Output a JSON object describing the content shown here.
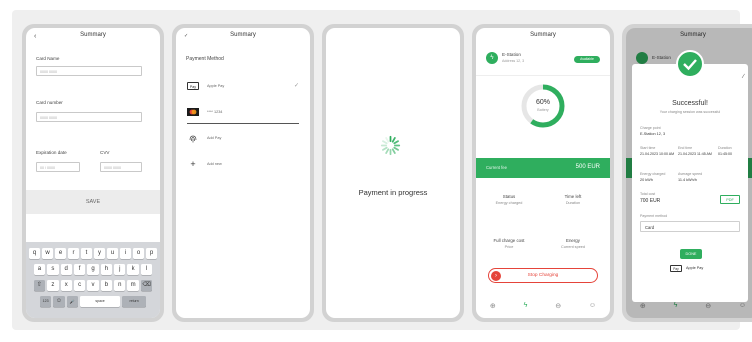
{
  "colors": {
    "accent": "#2fae5e",
    "danger": "#e5443a",
    "board": "#efefef",
    "frame": "#d2d2d2"
  },
  "screen1": {
    "title": "Summary",
    "back_icon": "chevron-left-icon",
    "labels": {
      "card_name": "Card Name",
      "card_number": "Card number",
      "expiration": "Expiration date",
      "cvv": "CVV"
    },
    "placeholders": {
      "card_name": "0000 0000",
      "card_number": "0000 0000",
      "expiration": "00 / 0000",
      "cvv": "0000 0000"
    },
    "save_label": "SAVE",
    "keyboard": {
      "row1": [
        "q",
        "w",
        "e",
        "r",
        "t",
        "y",
        "u",
        "i",
        "o",
        "p"
      ],
      "row2": [
        "a",
        "s",
        "d",
        "f",
        "g",
        "h",
        "j",
        "k",
        "l"
      ],
      "row3": [
        "z",
        "x",
        "c",
        "v",
        "b",
        "n",
        "m"
      ],
      "shift": "⇧",
      "backspace": "⌫",
      "num": "123",
      "emoji": "☺",
      "mic": "🎤",
      "space": "space",
      "return": "return"
    }
  },
  "screen2": {
    "title": "Summary",
    "section": "Payment Method",
    "methods": [
      {
        "icon": "apple-pay-icon",
        "badge": "Pay",
        "label": "Apple Pay",
        "selected": true
      },
      {
        "icon": "mastercard-icon",
        "badge": "",
        "label": "**** 1234",
        "selected": false
      },
      {
        "icon": "fingerprint-icon",
        "badge": "",
        "label": "Add Pay",
        "selected": false
      },
      {
        "icon": "plus-icon",
        "badge": "+",
        "label": "Add new",
        "selected": false
      }
    ],
    "check": "✓"
  },
  "screen3": {
    "message": "Payment in progress"
  },
  "screen4": {
    "title": "Summary",
    "station_name": "E-Station",
    "station_address": "Address 12, 3",
    "badge": "Available",
    "progress_percent": 60,
    "progress_label": "60%",
    "progress_sub": "Battery",
    "amount_label": "Current fee",
    "amount_value": "500 EUR",
    "tiles": [
      {
        "title": "Status",
        "sub": "Energy charged"
      },
      {
        "title": "Time left",
        "sub": "Duration"
      },
      {
        "title": "Full charge cost",
        "sub": "Price"
      },
      {
        "title": "Energy",
        "sub": "Current speed"
      }
    ],
    "stop_label": "Stop Charging"
  },
  "screen5": {
    "title": "Summary",
    "station_name": "E-Station",
    "heading": "Successful!",
    "subheading": "Your charging session was successful",
    "station_lbl": "Charge point",
    "station_val": "E-Station 12, 3",
    "col_labels": [
      "Start time",
      "End time",
      "Duration"
    ],
    "col_values": [
      "21.04.2023 10:00 AM",
      "21.04.2023 11:45 AM",
      "01:45:00"
    ],
    "energy_lbl": "Energy charged",
    "energy_val": "20 kWh",
    "speed_lbl": "Average speed",
    "speed_val": "11.4 kWh/h",
    "total_lbl": "Total cost",
    "total_val": "700 EUR",
    "invoice_btn": "PDF",
    "method_lbl": "Payment method",
    "method_val": "Card",
    "done_btn": "DONE",
    "apple_pay": "Apple Pay"
  }
}
